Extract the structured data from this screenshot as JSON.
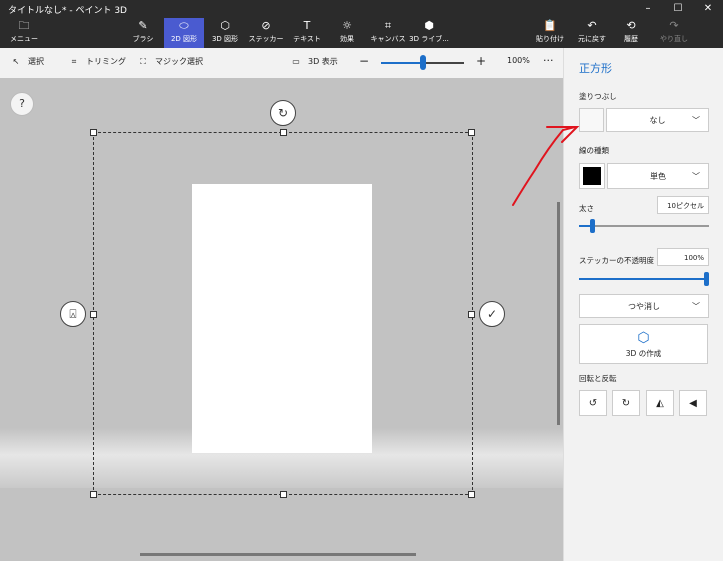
{
  "window": {
    "title": "タイトルなし* - ペイント 3D",
    "minimize_glyph": "–",
    "maximize_glyph": "☐",
    "close_glyph": "✕"
  },
  "ribbon": {
    "menu": {
      "label": "メニュー",
      "icon": "folder-icon"
    },
    "tools": [
      {
        "label": "ブラシ",
        "icon": "brush-icon"
      },
      {
        "label": "2D 図形",
        "icon": "2d-shapes-icon",
        "active": true
      },
      {
        "label": "3D 図形",
        "icon": "3d-shapes-icon"
      },
      {
        "label": "ステッカー",
        "icon": "sticker-icon"
      },
      {
        "label": "テキスト",
        "icon": "text-icon"
      },
      {
        "label": "効果",
        "icon": "effects-icon"
      },
      {
        "label": "キャンバス",
        "icon": "canvas-icon"
      },
      {
        "label": "3D ライブ...",
        "icon": "3d-library-icon"
      }
    ],
    "right": [
      {
        "label": "貼り付け",
        "icon": "paste-icon"
      },
      {
        "label": "元に戻す",
        "icon": "undo-icon"
      },
      {
        "label": "履歴",
        "icon": "history-icon"
      },
      {
        "label": "やり直し",
        "icon": "redo-icon",
        "disabled": true
      }
    ]
  },
  "toolbar": {
    "select_label": "選択",
    "crop_label": "トリミング",
    "magic_select_label": "マジック選択",
    "view3d_label": "3D 表示",
    "zoom_minus": "−",
    "zoom_plus": "+",
    "zoom_percent": "100%",
    "zoom_level": 0.5,
    "more": "···"
  },
  "canvas": {
    "help": "?",
    "confirm_glyph": "✓",
    "stamp_glyph": "⍓",
    "rotate_glyph": "↻"
  },
  "panel": {
    "title": "正方形",
    "fill_label": "塗りつぶし",
    "fill_value": "なし",
    "line_type_label": "線の種類",
    "line_type_value": "単色",
    "line_color": "#000000",
    "thickness_label": "太さ",
    "thickness_value": "10ピクセル",
    "thickness_level": 0.1,
    "opacity_label": "ステッカーの不透明度",
    "opacity_value": "100%",
    "opacity_level": 1.0,
    "finish_value": "つや消し",
    "make3d_label": "3D の作成",
    "rotate_flip_label": "回転と反転",
    "accent_color": "#1d6fc9",
    "annotation_color": "#e0141e"
  }
}
